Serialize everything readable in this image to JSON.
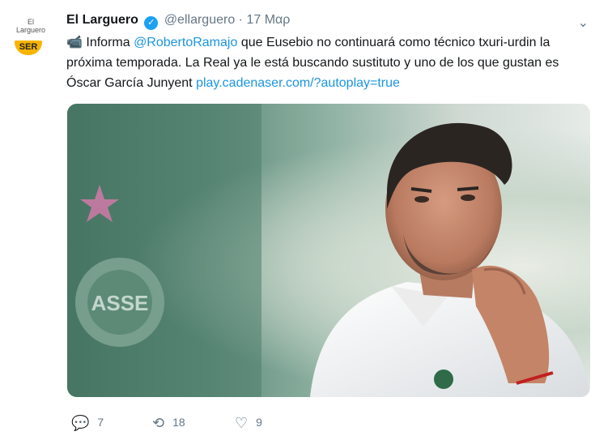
{
  "account": {
    "name": "El Larguero",
    "handle": "@ellarguero",
    "separator": "·",
    "date": "17 Μαρ",
    "logo_top": "El\nLarguero",
    "logo_brand": "SER"
  },
  "tweet": {
    "emoji": "📹",
    "t1": "Informa ",
    "mention": "@RobertoRamajo",
    "t2": " que Eusebio no continuará como técnico txuri-urdin la próxima temporada. La Real ya le está buscando sustituto y uno de los que gustan es Óscar García Junyent ",
    "link": "play.cadenaser.com/?autoplay=true"
  },
  "actions": {
    "replies": "7",
    "retweets": "18",
    "likes": "9"
  },
  "colors": {
    "link": "#1b95e0",
    "muted": "#657786",
    "verified": "#1da1f2",
    "brand": "#f7b500"
  },
  "icons": {
    "verified": "verified-badge-icon",
    "reply": "reply-icon",
    "retweet": "retweet-icon",
    "like": "heart-icon",
    "menu": "chevron-down-icon"
  }
}
